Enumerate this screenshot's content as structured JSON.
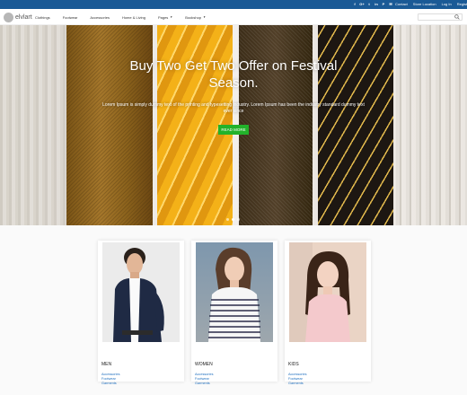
{
  "topbar": {
    "social": [
      "f",
      "G+",
      "t",
      "in",
      "P",
      "✉",
      "✆"
    ],
    "links": [
      "Contact",
      "Store Location",
      "Log In",
      "Register"
    ]
  },
  "header": {
    "logo": "elvlart",
    "nav": [
      {
        "label": "Clothings",
        "dropdown": false
      },
      {
        "label": "Footwear",
        "dropdown": false
      },
      {
        "label": "Accessories",
        "dropdown": false
      },
      {
        "label": "Home & Living",
        "dropdown": false
      },
      {
        "label": "Pages",
        "dropdown": true
      },
      {
        "label": "Bookshop",
        "dropdown": true
      }
    ],
    "search_placeholder": ""
  },
  "hero": {
    "title": "Buy Two Get Two Offer on Festival Season.",
    "subtitle": "Lorem Ipsum is simply dummy text of the printing and typesetting industry. Lorem Ipsum has been the industry standard dummy text ever since",
    "button": "READ MORE",
    "slide_count": 3,
    "active_slide": 1
  },
  "categories": [
    {
      "name": "MEN",
      "links": [
        "Accessories",
        "Footwear",
        "Garments"
      ]
    },
    {
      "name": "WOMEN",
      "links": [
        "Accessories",
        "Footwear",
        "Garments"
      ]
    },
    {
      "name": "KIDS",
      "links": [
        "Accessories",
        "Footwear",
        "Garments"
      ]
    }
  ],
  "colors": {
    "topbar": "#1a5a96",
    "accent_button": "#22b22a",
    "link": "#1f6fbf"
  }
}
